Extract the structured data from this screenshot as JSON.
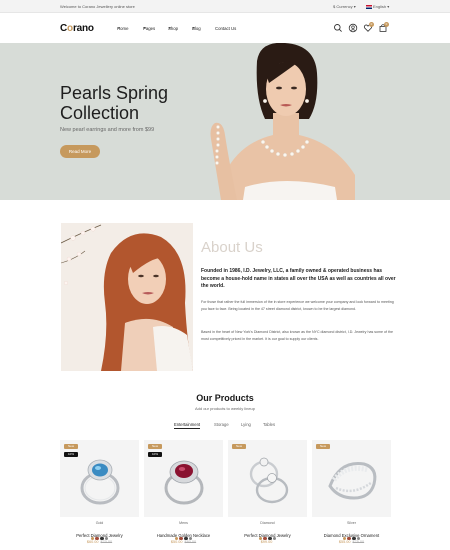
{
  "topbar": {
    "welcome": "Welcome to Corano Jewellery online store",
    "currency": "$ Currency",
    "language": "English"
  },
  "brand": {
    "logo_pre": "C",
    "logo_o": "o",
    "logo_post": "rano",
    "accent": "#c6995d"
  },
  "nav": [
    {
      "label": "Home",
      "active": true,
      "caret": true
    },
    {
      "label": "Pages",
      "caret": true
    },
    {
      "label": "Shop",
      "caret": true
    },
    {
      "label": "Blog",
      "caret": true
    },
    {
      "label": "Contact Us",
      "caret": false
    }
  ],
  "header_icons": [
    {
      "icon": "search-icon"
    },
    {
      "icon": "user-icon"
    },
    {
      "icon": "heart-icon",
      "badge": "0"
    },
    {
      "icon": "cart-icon",
      "badge": "0"
    }
  ],
  "hero": {
    "title_line1": "Pearls Spring",
    "title_line2": "Collection",
    "subtitle": "New pearl earrings and more from $99",
    "button": "Read More"
  },
  "about": {
    "title": "About Us",
    "lead": "Founded in 1986, I.D. Jewelry, LLC, a family owned & operated business has become a house-hold name in states all over the USA as well as countries all over the world.",
    "p1": "For those that rather the full immersion of the in store experience we welcome your company and look forward to meeting you face to face. Being located in the 47 street diamond district, known to be the largest diamond.",
    "p2": "Based in the heart of New York's Diamond District, also known as the NYC diamond district, I.D. Jewelry has some of the most competitively priced in the market. It is our goal to supply our clients."
  },
  "products": {
    "title": "Our Products",
    "subtitle": "Add our products to weekly lineup",
    "tabs": [
      "Entertainment",
      "Storage",
      "Lying",
      "Tables"
    ],
    "items": [
      {
        "category": "Gold",
        "name": "Perfect Diamond Jewelry",
        "price": "$60.00",
        "old_price": "$70.00",
        "new_tag": "New",
        "sale_tag": "10%",
        "stone": "#3a8bc2"
      },
      {
        "category": "Mens",
        "name": "Handmade Golden Necklace",
        "price": "$50.00",
        "old_price": "$80.00",
        "new_tag": "New",
        "sale_tag": "10%",
        "stone": "#8a1230"
      },
      {
        "category": "Diamond",
        "name": "Perfect Diamond Jewelry",
        "price": "$99.00",
        "old_price": "",
        "new_tag": "New",
        "sale_tag": "",
        "stone": "#e8e8e8"
      },
      {
        "category": "Silver",
        "name": "Diamond Exclusive Ornament",
        "price": "$55.00",
        "old_price": "$75.00",
        "new_tag": "New",
        "sale_tag": "",
        "stone": "#ffffff"
      }
    ],
    "swatch_colors": [
      "#c6995d",
      "#a34a3a",
      "#333333",
      "#888888"
    ]
  }
}
